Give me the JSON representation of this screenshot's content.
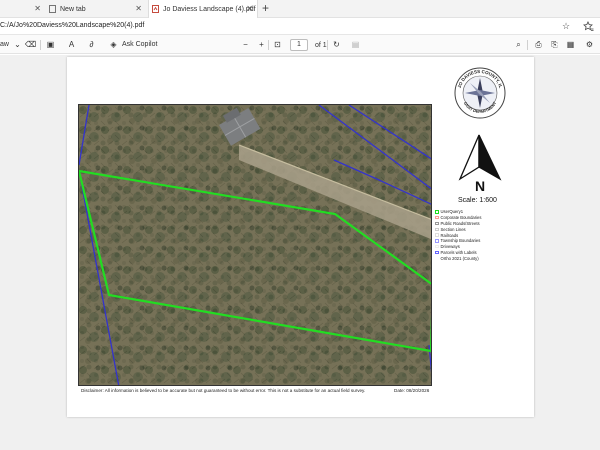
{
  "browser": {
    "tabs": [
      {
        "label": "",
        "active": false
      },
      {
        "label": "New tab",
        "active": false
      },
      {
        "label": "Jo Daviess Landscape (4).pdf",
        "active": true
      }
    ],
    "url": "C:/A/Jo%20Daviess%20Landscape%20(4).pdf"
  },
  "pdf_toolbar": {
    "draw_label": "aw",
    "ask_copilot_label": "Ask Copilot",
    "page_number": "1",
    "page_total": "of 1"
  },
  "document": {
    "seal_text": "JO DAVIESS COUNTY, IL · GIS/IT DEPARTMENT",
    "north_label": "N",
    "scale_label": "Scale: 1:600",
    "legend": [
      {
        "label": "UserQuery1",
        "color": "#22dd22"
      },
      {
        "label": "Corporate Boundaries",
        "color": "#ff9999"
      },
      {
        "label": "Public Roads/Streets",
        "color": "#999999"
      },
      {
        "label": "Section Lines",
        "color": "#cccccc"
      },
      {
        "label": "Railroads",
        "color": "#dddddd"
      },
      {
        "label": "Township Boundaries",
        "color": "#9999ff"
      },
      {
        "label": "Driveways",
        "color": "#eeeeee"
      },
      {
        "label": "Parcels with Labels",
        "color": "#6666ff"
      },
      {
        "label": "Ortho 2021 (County)",
        "color": ""
      }
    ],
    "disclaimer": "Disclaimer: All information is believed to be accurate but not guaranteed to be without error. This is not a substitute for an actual field survey.",
    "date_label": "Date:",
    "date_value": "08/20/2026"
  },
  "colors": {
    "parcel_outline": "#22dd22",
    "parcel_lines": "#3333cc",
    "pdf_tab_icon": "#c0392b"
  }
}
